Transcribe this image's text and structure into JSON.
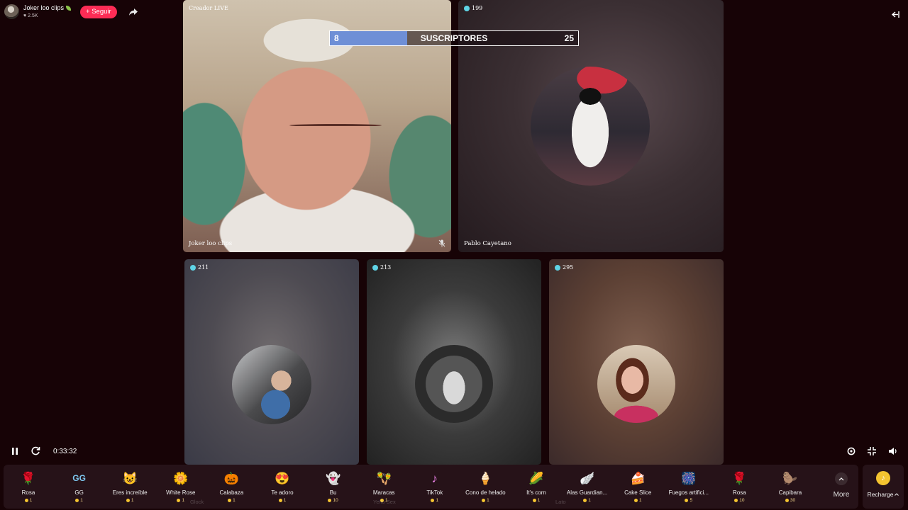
{
  "host": {
    "name": "Joker loo clips",
    "likes": "2.5K",
    "follow_label": "+ Seguir"
  },
  "subscribers": {
    "left_count": "8",
    "title": "SUSCRIPTORES",
    "right_count": "25",
    "progress_fraction": 0.31
  },
  "streams": {
    "main": {
      "top_label": "Creador LIVE",
      "bottom_label": "Joker loo clips"
    },
    "top_right": {
      "viewers": "199",
      "name": "Pablo Cayetano"
    },
    "bottom_left": {
      "viewers": "211",
      "faint_name": "Glock"
    },
    "bottom_mid": {
      "viewers": "213",
      "faint_name": "Yeffo Sex"
    },
    "bottom_right": {
      "viewers": "295",
      "faint_name": "Lato"
    }
  },
  "player": {
    "time": "0:33:32"
  },
  "gifts": [
    {
      "name": "Rosa",
      "price": "1",
      "icon": "rose-icon",
      "glyph": "🌹",
      "color": "#c2183a"
    },
    {
      "name": "GG",
      "price": "1",
      "icon": "gg-icon",
      "glyph": "GG",
      "color": "#7ec8f0"
    },
    {
      "name": "Eres increíble",
      "price": "1",
      "icon": "cat-icon",
      "glyph": "😺",
      "color": "#e0a055"
    },
    {
      "name": "White Rose",
      "price": "1",
      "icon": "white-rose-icon",
      "glyph": "🌼",
      "color": "#f4f1ea"
    },
    {
      "name": "Calabaza",
      "price": "1",
      "icon": "pumpkin-icon",
      "glyph": "🎃",
      "color": "#f08a1c"
    },
    {
      "name": "Te adoro",
      "price": "1",
      "icon": "heart-face-icon",
      "glyph": "😍",
      "color": "#e84b5a"
    },
    {
      "name": "Bu",
      "price": "10",
      "icon": "ghost-icon",
      "glyph": "👻",
      "color": "#e7e7f0"
    },
    {
      "name": "Maracas",
      "price": "1",
      "icon": "maracas-icon",
      "glyph": "🪇",
      "color": "#d64a4a"
    },
    {
      "name": "TikTok",
      "price": "1",
      "icon": "tiktok-icon",
      "glyph": "♪",
      "color": "#e67fe2"
    },
    {
      "name": "Cono de helado",
      "price": "1",
      "icon": "ice-cream-icon",
      "glyph": "🍦",
      "color": "#f3a6c0"
    },
    {
      "name": "It's corn",
      "price": "1",
      "icon": "corn-icon",
      "glyph": "🌽",
      "color": "#f2c230"
    },
    {
      "name": "Alas Guardian...",
      "price": "1",
      "icon": "wings-icon",
      "glyph": "🪽",
      "color": "#bcd9f2"
    },
    {
      "name": "Cake Slice",
      "price": "1",
      "icon": "cake-icon",
      "glyph": "🍰",
      "color": "#f2b27a"
    },
    {
      "name": "Fuegos artifici...",
      "price": "5",
      "icon": "fireworks-icon",
      "glyph": "🎆",
      "color": "#a55de0"
    },
    {
      "name": "Rosa",
      "price": "10",
      "icon": "rose-icon",
      "glyph": "🌹",
      "color": "#c2183a"
    },
    {
      "name": "Capibara",
      "price": "30",
      "icon": "capybara-icon",
      "glyph": "🦫",
      "color": "#b9763a"
    }
  ],
  "more_label": "More",
  "recharge_label": "Recharge"
}
